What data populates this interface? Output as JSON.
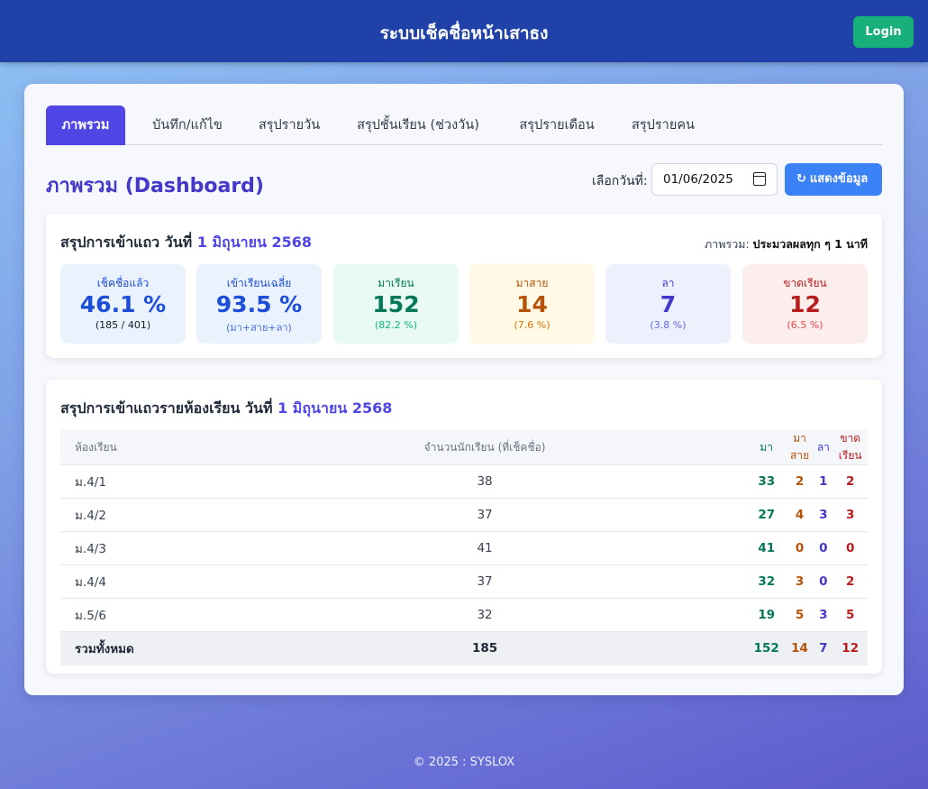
{
  "header": {
    "title": "ระบบเช็คชื่อหน้าเสาธง",
    "login_label": "Login"
  },
  "tabs": [
    {
      "label": "ภาพรวม",
      "active": true
    },
    {
      "label": "บันทึก/แก้ไข",
      "active": false
    },
    {
      "label": "สรุปรายวัน",
      "active": false
    },
    {
      "label": "สรุปชั้นเรียน (ช่วงวัน)",
      "active": false
    },
    {
      "label": "สรุปรายเดือน",
      "active": false
    },
    {
      "label": "สรุปรายคน",
      "active": false
    }
  ],
  "dashboard": {
    "title": "ภาพรวม (Dashboard)",
    "date_label": "เลือกวันที่:",
    "date_value": "01/06/2025",
    "show_button_label": "แสดงข้อมูล",
    "show_button_icon": "refresh-icon"
  },
  "summary": {
    "heading_prefix": "สรุปการเข้าแถว วันที่",
    "heading_date": "1 มิถุนายน 2568",
    "refresh_label": "ภาพรวม:",
    "refresh_text": "ประมวลผลทุก ๆ 1 นาที",
    "cards": [
      {
        "label": "เช็คชื่อแล้ว",
        "value": "46.1 %",
        "sub": "(185 / 401)",
        "bg": "#eaf2fe",
        "color": "#1d4ed8",
        "sub_color": "#111827"
      },
      {
        "label": "เข้าเรียนเฉลี่ย",
        "value": "93.5 %",
        "sub": "(มา+สาย+ลา)",
        "bg": "#eaf2fe",
        "color": "#1d4ed8",
        "sub_color": "#4b6bd8"
      },
      {
        "label": "มาเรียน",
        "value": "152",
        "sub": "(82.2 %)",
        "bg": "#e8faf1",
        "color": "#047857",
        "sub_color": "#10b981"
      },
      {
        "label": "มาสาย",
        "value": "14",
        "sub": "(7.6 %)",
        "bg": "#fff9e5",
        "color": "#b45309",
        "sub_color": "#d97706"
      },
      {
        "label": "ลา",
        "value": "7",
        "sub": "(3.8 %)",
        "bg": "#edf1fd",
        "color": "#4338ca",
        "sub_color": "#6366f1"
      },
      {
        "label": "ขาดเรียน",
        "value": "12",
        "sub": "(6.5 %)",
        "bg": "#fdeeee",
        "color": "#b91c1c",
        "sub_color": "#ef4444"
      }
    ]
  },
  "class_summary": {
    "heading_prefix": "สรุปการเข้าแถวรายห้องเรียน วันที่",
    "heading_date": "1 มิถุนายน 2568",
    "columns": [
      "ห้องเรียน",
      "จำนวนนักเรียน (ที่เช็คชื่อ)",
      "มา",
      "มาสาย",
      "ลา",
      "ขาดเรียน"
    ],
    "column_colors": [
      "#6b7280",
      "#6b7280",
      "#047857",
      "#b45309",
      "#4338ca",
      "#b91c1c"
    ],
    "rows": [
      [
        "ม.4/1",
        "38",
        "33",
        "2",
        "1",
        "2"
      ],
      [
        "ม.4/2",
        "37",
        "27",
        "4",
        "3",
        "3"
      ],
      [
        "ม.4/3",
        "41",
        "41",
        "0",
        "0",
        "0"
      ],
      [
        "ม.4/4",
        "37",
        "32",
        "3",
        "0",
        "2"
      ],
      [
        "ม.5/6",
        "32",
        "19",
        "5",
        "3",
        "5"
      ]
    ],
    "total": [
      "รวมทั้งหมด",
      "185",
      "152",
      "14",
      "7",
      "12"
    ]
  },
  "footer": {
    "text": "© 2025 : SYSLOX"
  }
}
